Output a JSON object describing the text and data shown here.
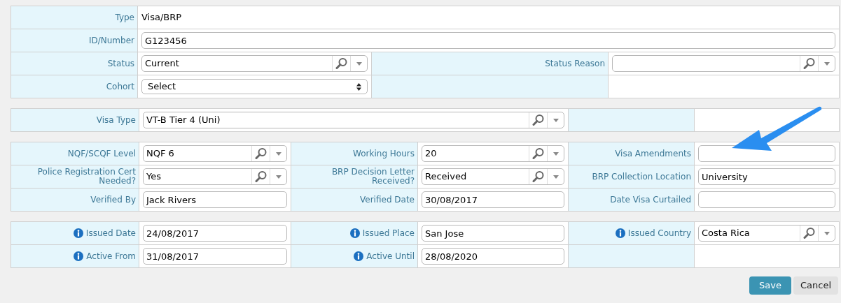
{
  "sections": [
    {
      "rows": [
        [
          {
            "kind": "label",
            "text": "Type"
          },
          {
            "kind": "text",
            "value": "Visa/BRP",
            "wide": true
          }
        ],
        [
          {
            "kind": "label",
            "text": "ID/Number"
          },
          {
            "kind": "input",
            "value": "G123456",
            "wide": true
          }
        ],
        [
          {
            "kind": "label",
            "text": "Status"
          },
          {
            "kind": "lookup",
            "value": "Current"
          },
          {
            "kind": "label",
            "text": "Status Reason"
          },
          {
            "kind": "lookup"
          }
        ],
        [
          {
            "kind": "label",
            "text": "Cohort"
          },
          {
            "kind": "select",
            "value": "Select"
          },
          {
            "kind": "label"
          },
          {
            "kind": "blank"
          }
        ]
      ]
    },
    {
      "rows": [
        [
          {
            "kind": "label",
            "text": "Visa Type"
          },
          {
            "kind": "lookup",
            "value": "VT-B Tier 4 (Uni)",
            "wide": true
          },
          {
            "kind": "label"
          },
          {
            "kind": "blank"
          }
        ]
      ]
    },
    {
      "rows": [
        [
          {
            "kind": "label",
            "text": "NQF/SCQF Level"
          },
          {
            "kind": "lookup",
            "value": "NQF 6"
          },
          {
            "kind": "label",
            "text": "Working Hours"
          },
          {
            "kind": "lookup",
            "value": "20"
          },
          {
            "kind": "label",
            "text": "Visa Amendments"
          },
          {
            "kind": "input"
          }
        ],
        [
          {
            "kind": "label",
            "text": "Police Registration Cert Needed?"
          },
          {
            "kind": "lookup",
            "value": "Yes"
          },
          {
            "kind": "label",
            "text": "BRP Decision Letter Received?"
          },
          {
            "kind": "lookup",
            "value": "Received"
          },
          {
            "kind": "label",
            "text": "BRP Collection Location"
          },
          {
            "kind": "input",
            "value": "University"
          }
        ],
        [
          {
            "kind": "label",
            "text": "Verified By"
          },
          {
            "kind": "input",
            "value": "Jack Rivers"
          },
          {
            "kind": "label",
            "text": "Verified Date"
          },
          {
            "kind": "input",
            "value": "30/08/2017"
          },
          {
            "kind": "label",
            "text": "Date Visa Curtailed"
          },
          {
            "kind": "input"
          }
        ]
      ]
    },
    {
      "rows": [
        [
          {
            "kind": "label",
            "text": "Issued Date",
            "info": true
          },
          {
            "kind": "input",
            "value": "24/08/2017"
          },
          {
            "kind": "label",
            "text": "Issued Place",
            "info": true
          },
          {
            "kind": "input",
            "value": "San Jose"
          },
          {
            "kind": "label",
            "text": "Issued Country",
            "info": true
          },
          {
            "kind": "lookup",
            "value": "Costa Rica"
          }
        ],
        [
          {
            "kind": "label",
            "text": "Active From",
            "info": true
          },
          {
            "kind": "input",
            "value": "31/08/2017"
          },
          {
            "kind": "label",
            "text": "Active Until",
            "info": true
          },
          {
            "kind": "input",
            "value": "28/08/2020"
          },
          {
            "kind": "label"
          },
          {
            "kind": "blank"
          }
        ]
      ]
    }
  ],
  "buttons": [
    {
      "kind": "primary",
      "label": "Save"
    },
    {
      "kind": "secondary",
      "label": "Cancel"
    }
  ]
}
